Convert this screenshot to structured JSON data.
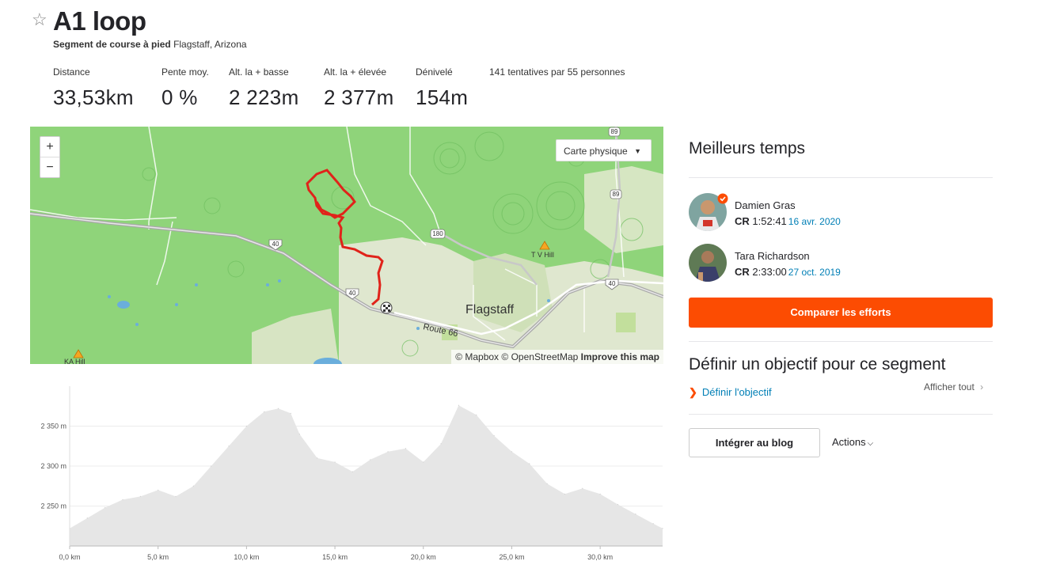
{
  "segment": {
    "title": "A1 loop",
    "type": "Segment de course à pied",
    "location": "Flagstaff, Arizona"
  },
  "stats": [
    {
      "label": "Distance",
      "value": "33,53km"
    },
    {
      "label": "Pente moy.",
      "value": "0 %"
    },
    {
      "label": "Alt. la + basse",
      "value": "2 223m"
    },
    {
      "label": "Alt. la + élevée",
      "value": "2 377m"
    },
    {
      "label": "Dénivelé",
      "value": "154m"
    }
  ],
  "attempts": "141 tentatives par 55 personnes",
  "map": {
    "zoom_in": "+",
    "zoom_out": "−",
    "map_type": "Carte physique",
    "credit_mapbox": "© Mapbox",
    "credit_osm": "© OpenStreetMap",
    "credit_improve": "Improve this map",
    "labels": {
      "city": "Flagstaff",
      "tv_hill": "T V Hill",
      "ka_hill": "KA Hill",
      "route66": "Route 66",
      "i40_a": "40",
      "i40_b": "40",
      "i40_c": "40",
      "us180": "180",
      "us89_a": "89",
      "us89_b": "89"
    },
    "route_color": "#e0231a"
  },
  "elevation": {
    "y_ticks": [
      "2 350 m",
      "2 300 m",
      "2 250 m"
    ],
    "x_ticks": [
      "0,0 km",
      "5,0 km",
      "10,0 km",
      "15,0 km",
      "20,0 km",
      "25,0 km",
      "30,0 km"
    ]
  },
  "chart_data": {
    "type": "area",
    "xlabel": "",
    "ylabel": "",
    "x_unit": "km",
    "y_unit": "m",
    "xlim": [
      0,
      33.53
    ],
    "ylim": [
      2200,
      2400
    ],
    "x": [
      0,
      1,
      2,
      3,
      4,
      5,
      6,
      7,
      8,
      9,
      10,
      11,
      11.8,
      12.5,
      13,
      14,
      15,
      16,
      17,
      18,
      19,
      20,
      21,
      22,
      23,
      24,
      25,
      26,
      27,
      28,
      29,
      30,
      31,
      32,
      33,
      33.53
    ],
    "y": [
      2222,
      2235,
      2248,
      2258,
      2262,
      2270,
      2262,
      2275,
      2300,
      2325,
      2350,
      2368,
      2372,
      2366,
      2340,
      2310,
      2305,
      2293,
      2308,
      2318,
      2322,
      2305,
      2328,
      2376,
      2364,
      2338,
      2318,
      2303,
      2278,
      2265,
      2272,
      2265,
      2252,
      2240,
      2228,
      2222
    ],
    "fill": "#e6e6e6"
  },
  "leaderboard": {
    "title": "Meilleurs temps",
    "athletes": [
      {
        "name": "Damien Gras",
        "cr": "CR",
        "time": "1:52:41",
        "date": "16 avr. 2020"
      },
      {
        "name": "Tara Richardson",
        "cr": "CR",
        "time": "2:33:00",
        "date": "27 oct. 2019"
      }
    ],
    "compare_label": "Comparer les efforts"
  },
  "goal": {
    "title": "Définir un objectif pour ce segment",
    "link": "Définir l'objectif",
    "show_all": "Afficher tout"
  },
  "actions": {
    "embed": "Intégrer au blog",
    "actions": "Actions"
  },
  "colors": {
    "accent": "#fc4c02",
    "link": "#007fb6",
    "map_green": "#8fd47a"
  }
}
